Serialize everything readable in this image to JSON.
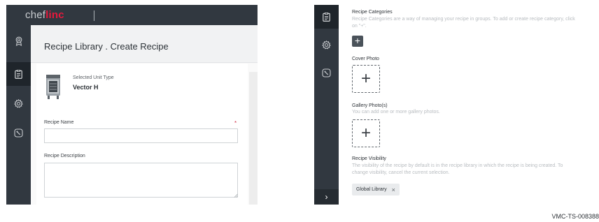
{
  "left_screen": {
    "logo": {
      "prefix": "chef",
      "brand": "linc"
    },
    "page_title": "Recipe Library . Create Recipe",
    "unit": {
      "caption": "Selected Unit Type",
      "name": "Vector H"
    },
    "recipe_name": {
      "label": "Recipe Name",
      "required_mark": "*",
      "value": "",
      "placeholder": ""
    },
    "recipe_description": {
      "label": "Recipe Description",
      "value": "",
      "placeholder": ""
    },
    "sidebar_icons": [
      "award-icon",
      "recipe-doc-icon",
      "gear-icon",
      "tag-icon"
    ],
    "active_sidebar_item": "recipe-doc-icon"
  },
  "right_screen": {
    "sidebar_icons": [
      "recipe-doc-icon",
      "gear-icon",
      "tag-icon"
    ],
    "active_sidebar_item": "recipe-doc-icon",
    "expand_icon": "›",
    "recipe_categories": {
      "label": "Recipe Categories",
      "help": "Recipe Categories are a way of managing your recipe in groups. To add or create recipe category, click on \"+\".",
      "add_symbol": "+"
    },
    "cover_photo": {
      "label": "Cover Photo",
      "add_symbol": "+"
    },
    "gallery_photo": {
      "label": "Gallery Photo(s)",
      "help": "You can add one or more gallery photos.",
      "add_symbol": "+"
    },
    "recipe_visibility": {
      "label": "Recipe Visibility",
      "help": "The visibility of the recipe by default is in the recipe library in which the recipe is being created. To change visibility, cancel the current selection.",
      "chip": "Global Library",
      "chip_remove": "×"
    }
  },
  "reference_code": "VMC-TS-008388",
  "colors": {
    "sidebar": "#313840",
    "sidebar_active": "#1f252b",
    "brand_red": "#e8193c",
    "required": "#d0334a"
  }
}
